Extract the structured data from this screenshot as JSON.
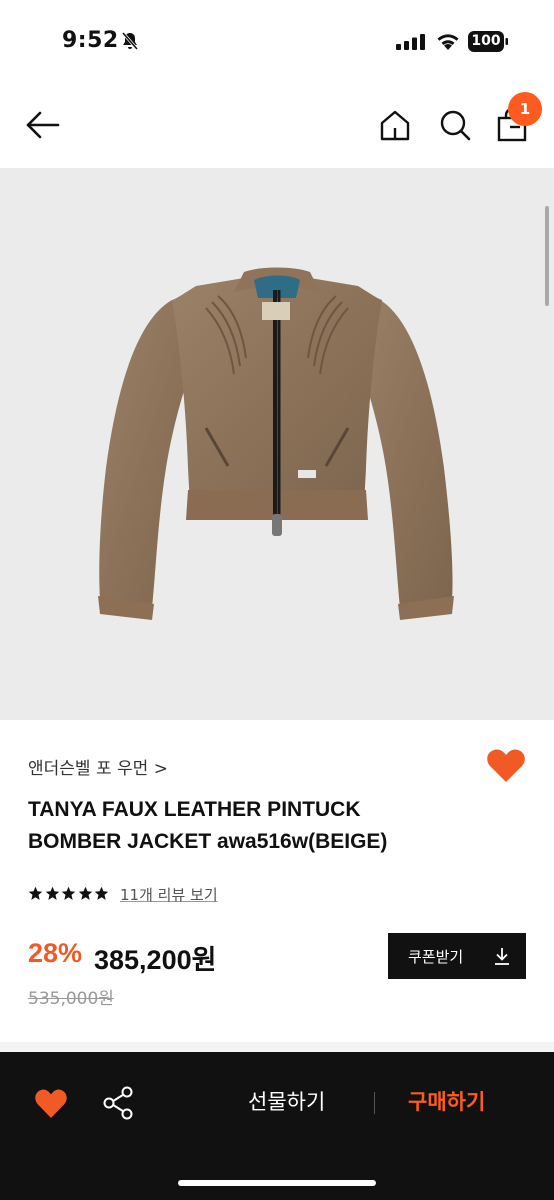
{
  "status_bar": {
    "time": "9:52",
    "battery": "100"
  },
  "header": {
    "cart_count": "1"
  },
  "product": {
    "brand": "앤더슨벨 포 우먼 >",
    "title_line1": "TANYA FAUX LEATHER PINTUCK",
    "title_line2": "BOMBER JACKET awa516w(BEIGE)",
    "rating_stars": 5,
    "review_link": "11개 리뷰 보기",
    "discount": "28%",
    "price": "385,200원",
    "original_price": "535,000원",
    "coupon_label": "쿠폰받기"
  },
  "bottom_bar": {
    "gift_label": "선물하기",
    "buy_label": "구매하기"
  },
  "colors": {
    "accent": "#f15a24",
    "dark": "#111111"
  }
}
